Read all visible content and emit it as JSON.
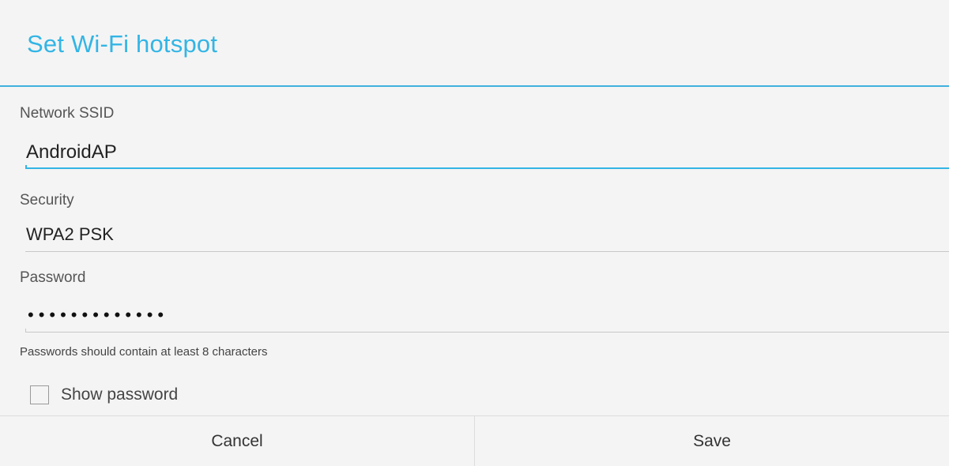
{
  "dialog": {
    "title": "Set Wi-Fi hotspot"
  },
  "ssid": {
    "label": "Network SSID",
    "value": "AndroidAP"
  },
  "security": {
    "label": "Security",
    "selected": "WPA2 PSK"
  },
  "password": {
    "label": "Password",
    "masked_value": "•••••••••••••",
    "hint": "Passwords should contain at least 8 characters"
  },
  "show_password": {
    "label": "Show password",
    "checked": false
  },
  "buttons": {
    "cancel": "Cancel",
    "save": "Save"
  },
  "colors": {
    "accent": "#33b5e5",
    "background": "#f4f4f4"
  }
}
